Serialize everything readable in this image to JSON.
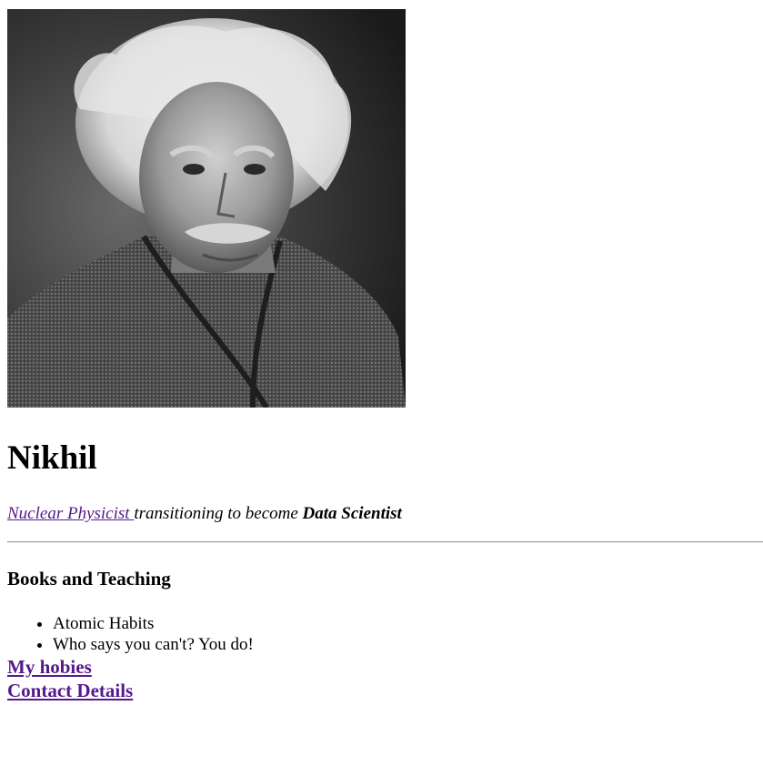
{
  "profile": {
    "image_alt": "portrait photo",
    "name": "Nikhil"
  },
  "tagline": {
    "link_text": "Nuclear Physicist ",
    "middle_text": "transitioning to become ",
    "bold_text": "Data Scientist"
  },
  "books_section": {
    "title": "Books and Teaching",
    "items": [
      "Atomic Habits",
      "Who says you can't? You do!"
    ]
  },
  "links": {
    "hobbies": "My hobies",
    "contact": "Contact Details"
  },
  "colors": {
    "link_visited": "#551a8b",
    "text": "#000000",
    "background": "#ffffff"
  }
}
